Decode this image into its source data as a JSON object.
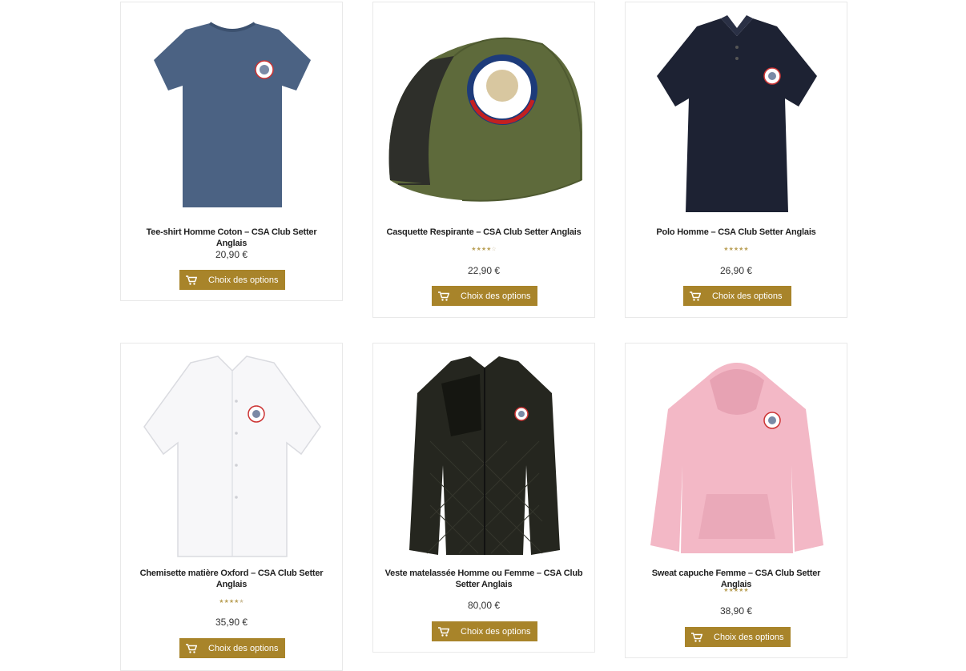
{
  "products": [
    {
      "title": "Tee-shirt Homme Coton – CSA Club Setter Anglais",
      "price": "20,90",
      "currency": "€",
      "rating": 0,
      "button": "Choix des options"
    },
    {
      "title": "Casquette Respirante – CSA Club Setter Anglais",
      "price": "22,90",
      "currency": "€",
      "rating": 4,
      "button": "Choix des options"
    },
    {
      "title": "Polo Homme – CSA Club Setter Anglais",
      "price": "26,90",
      "currency": "€",
      "rating": 5,
      "button": "Choix des options"
    },
    {
      "title": "Chemisette matière Oxford – CSA Club Setter Anglais",
      "price": "35,90",
      "currency": "€",
      "rating": 4.5,
      "button": "Choix des options"
    },
    {
      "title": "Veste matelassée Homme ou Femme – CSA Club Setter Anglais",
      "price": "80,00",
      "currency": "€",
      "rating": 0,
      "button": "Choix des options"
    },
    {
      "title": "Sweat capuche Femme – CSA Club Setter Anglais",
      "price": "38,90",
      "currency": "€",
      "rating": 5,
      "button": "Choix des options"
    }
  ],
  "icons": {
    "button_icon": "shopping-cart-icon"
  },
  "colors": {
    "button": "#a8842a",
    "stars": "#bba25a",
    "card_border": "#e9e9e9"
  }
}
